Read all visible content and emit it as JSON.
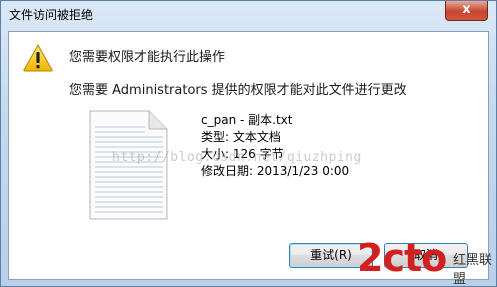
{
  "window": {
    "title": "文件访问被拒绝",
    "close_glyph": "x"
  },
  "dialog": {
    "heading": "您需要权限才能执行此操作",
    "message": "您需要 Administrators 提供的权限才能对此文件进行更改",
    "file": {
      "name": "c_pan - 副本.txt",
      "type": "类型: 文本文档",
      "size": "大小: 126 字节",
      "modified": "修改日期: 2013/1/23 0:00"
    },
    "watermark": "http://blog.csdn.net/qiuzhping",
    "buttons": {
      "retry": "重试(R)",
      "cancel": "取消"
    }
  },
  "logo": {
    "text": "2cto",
    "text_cn": "红黑联盟"
  },
  "icons": {
    "warning": "warning-icon",
    "file": "text-file-icon",
    "close": "close-icon"
  },
  "colors": {
    "title_bg": "#c5d9ef",
    "close_red": "#c7452f",
    "logo_red": "#d21f1f",
    "button_border": "#3c7fb1"
  }
}
